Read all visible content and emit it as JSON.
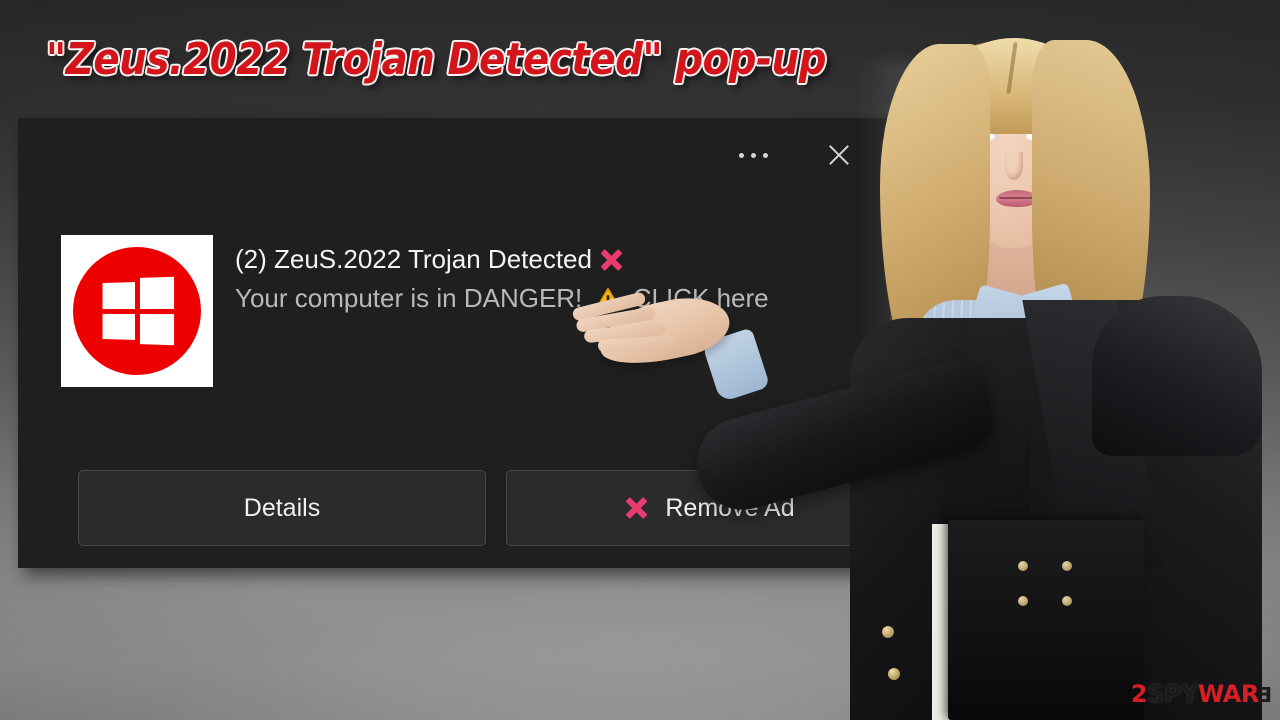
{
  "page": {
    "headline": "\"Zeus.2022 Trojan Detected\" pop-up"
  },
  "popup": {
    "controls": {
      "more_options_label": "•••",
      "close_label": "×"
    },
    "icon": {
      "name": "windows-logo-red-circle"
    },
    "notification": {
      "title": "(2) ZeuS.2022 Trojan Detected",
      "message_line1": "Your computer is in DANGER!",
      "message_line2": "CLICK",
      "message_line3": "here"
    },
    "buttons": {
      "details_label": "Details",
      "remove_label": "Remove Ad"
    }
  },
  "watermark": {
    "part1": "2",
    "part2": "SPY",
    "part3": "WAR",
    "part4": "E"
  },
  "colors": {
    "headline_red": "#d4141b",
    "popup_background": "#1f1f1f",
    "notification_title": "#f3f3f3",
    "notification_message": "#b9b9b9",
    "x_mark_pink": "#e83b6e",
    "warning_yellow": "#f5b31a",
    "windows_badge_red": "#ee0000",
    "button_background": "#2b2b2b",
    "watermark_red": "#d71f26"
  }
}
